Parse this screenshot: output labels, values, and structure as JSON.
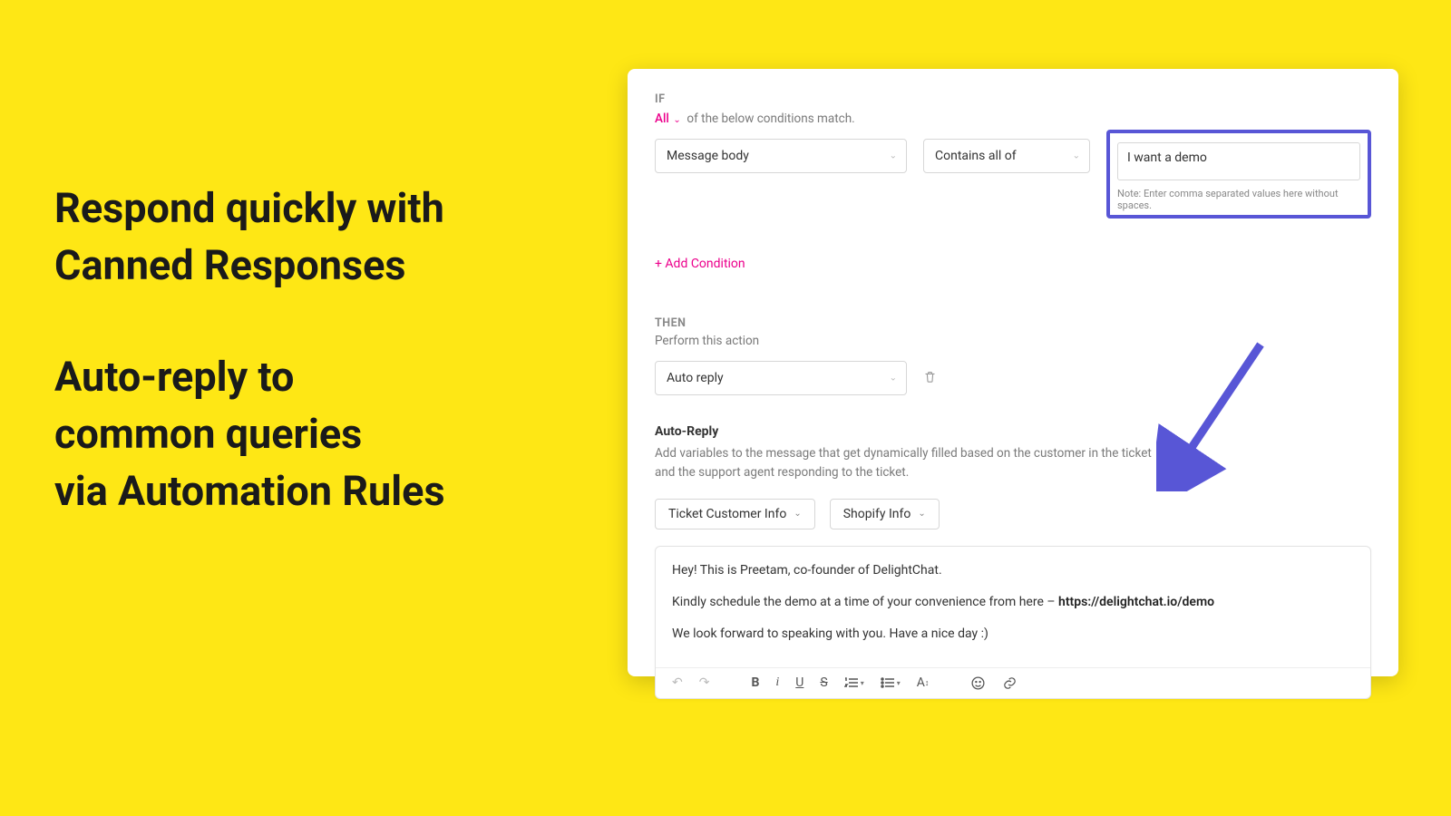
{
  "promo": {
    "line1": "Respond quickly with",
    "line2": "Canned Responses",
    "line3": "Auto-reply to",
    "line4": "common queries",
    "line5": "via Automation Rules"
  },
  "if": {
    "label": "IF",
    "quantifier": "All",
    "quantifier_suffix": "of the below conditions match.",
    "field": "Message body",
    "operator": "Contains all of",
    "value": "I want a demo",
    "note": "Note: Enter comma separated values here without spaces.",
    "add": "+ Add Condition"
  },
  "then": {
    "label": "THEN",
    "perform": "Perform this action",
    "action": "Auto reply"
  },
  "autoreply": {
    "title": "Auto-Reply",
    "desc": "Add variables to the message that get dynamically filled based on the customer in the ticket and the support agent responding to the ticket.",
    "chip1": "Ticket Customer Info",
    "chip2": "Shopify Info",
    "body": {
      "p1": "Hey! This is Preetam, co-founder of DelightChat.",
      "p2_prefix": "Kindly schedule the demo at a time of your convenience from here – ",
      "p2_link": "https://delightchat.io/demo",
      "p3": "We look forward to speaking with you. Have a nice day :)"
    }
  },
  "toolbar": {
    "bold": "B",
    "italic": "i",
    "underline": "U",
    "strike": "S",
    "font": "A"
  }
}
